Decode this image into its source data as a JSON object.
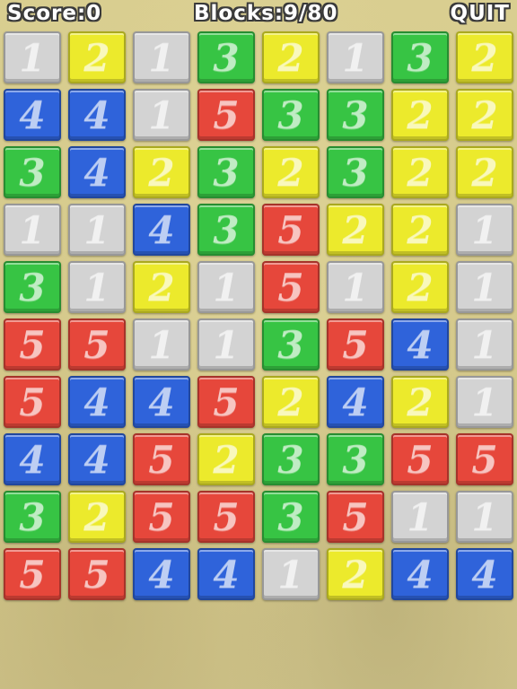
{
  "hud": {
    "score_label": "Score:0",
    "blocks_label": "Blocks:9/80",
    "quit_label": "QUIT"
  },
  "colors": {
    "1": "#d3d3d3",
    "2": "#ecea2c",
    "3": "#37c444",
    "4": "#2f63da",
    "5": "#e6473b",
    "background": "#d8cd8e"
  },
  "grid": {
    "rows": 10,
    "cols": 8,
    "cells": [
      [
        1,
        2,
        1,
        3,
        2,
        1,
        3,
        2
      ],
      [
        4,
        4,
        1,
        5,
        3,
        3,
        2,
        2
      ],
      [
        3,
        4,
        2,
        3,
        2,
        3,
        2,
        2
      ],
      [
        1,
        1,
        4,
        3,
        5,
        2,
        2,
        1
      ],
      [
        3,
        1,
        2,
        1,
        5,
        1,
        2,
        1
      ],
      [
        5,
        5,
        1,
        1,
        3,
        5,
        4,
        1
      ],
      [
        5,
        4,
        4,
        5,
        2,
        4,
        2,
        1
      ],
      [
        4,
        4,
        5,
        2,
        3,
        3,
        5,
        5
      ],
      [
        3,
        2,
        5,
        5,
        3,
        5,
        1,
        1
      ],
      [
        5,
        5,
        4,
        4,
        1,
        2,
        4,
        4
      ]
    ]
  }
}
